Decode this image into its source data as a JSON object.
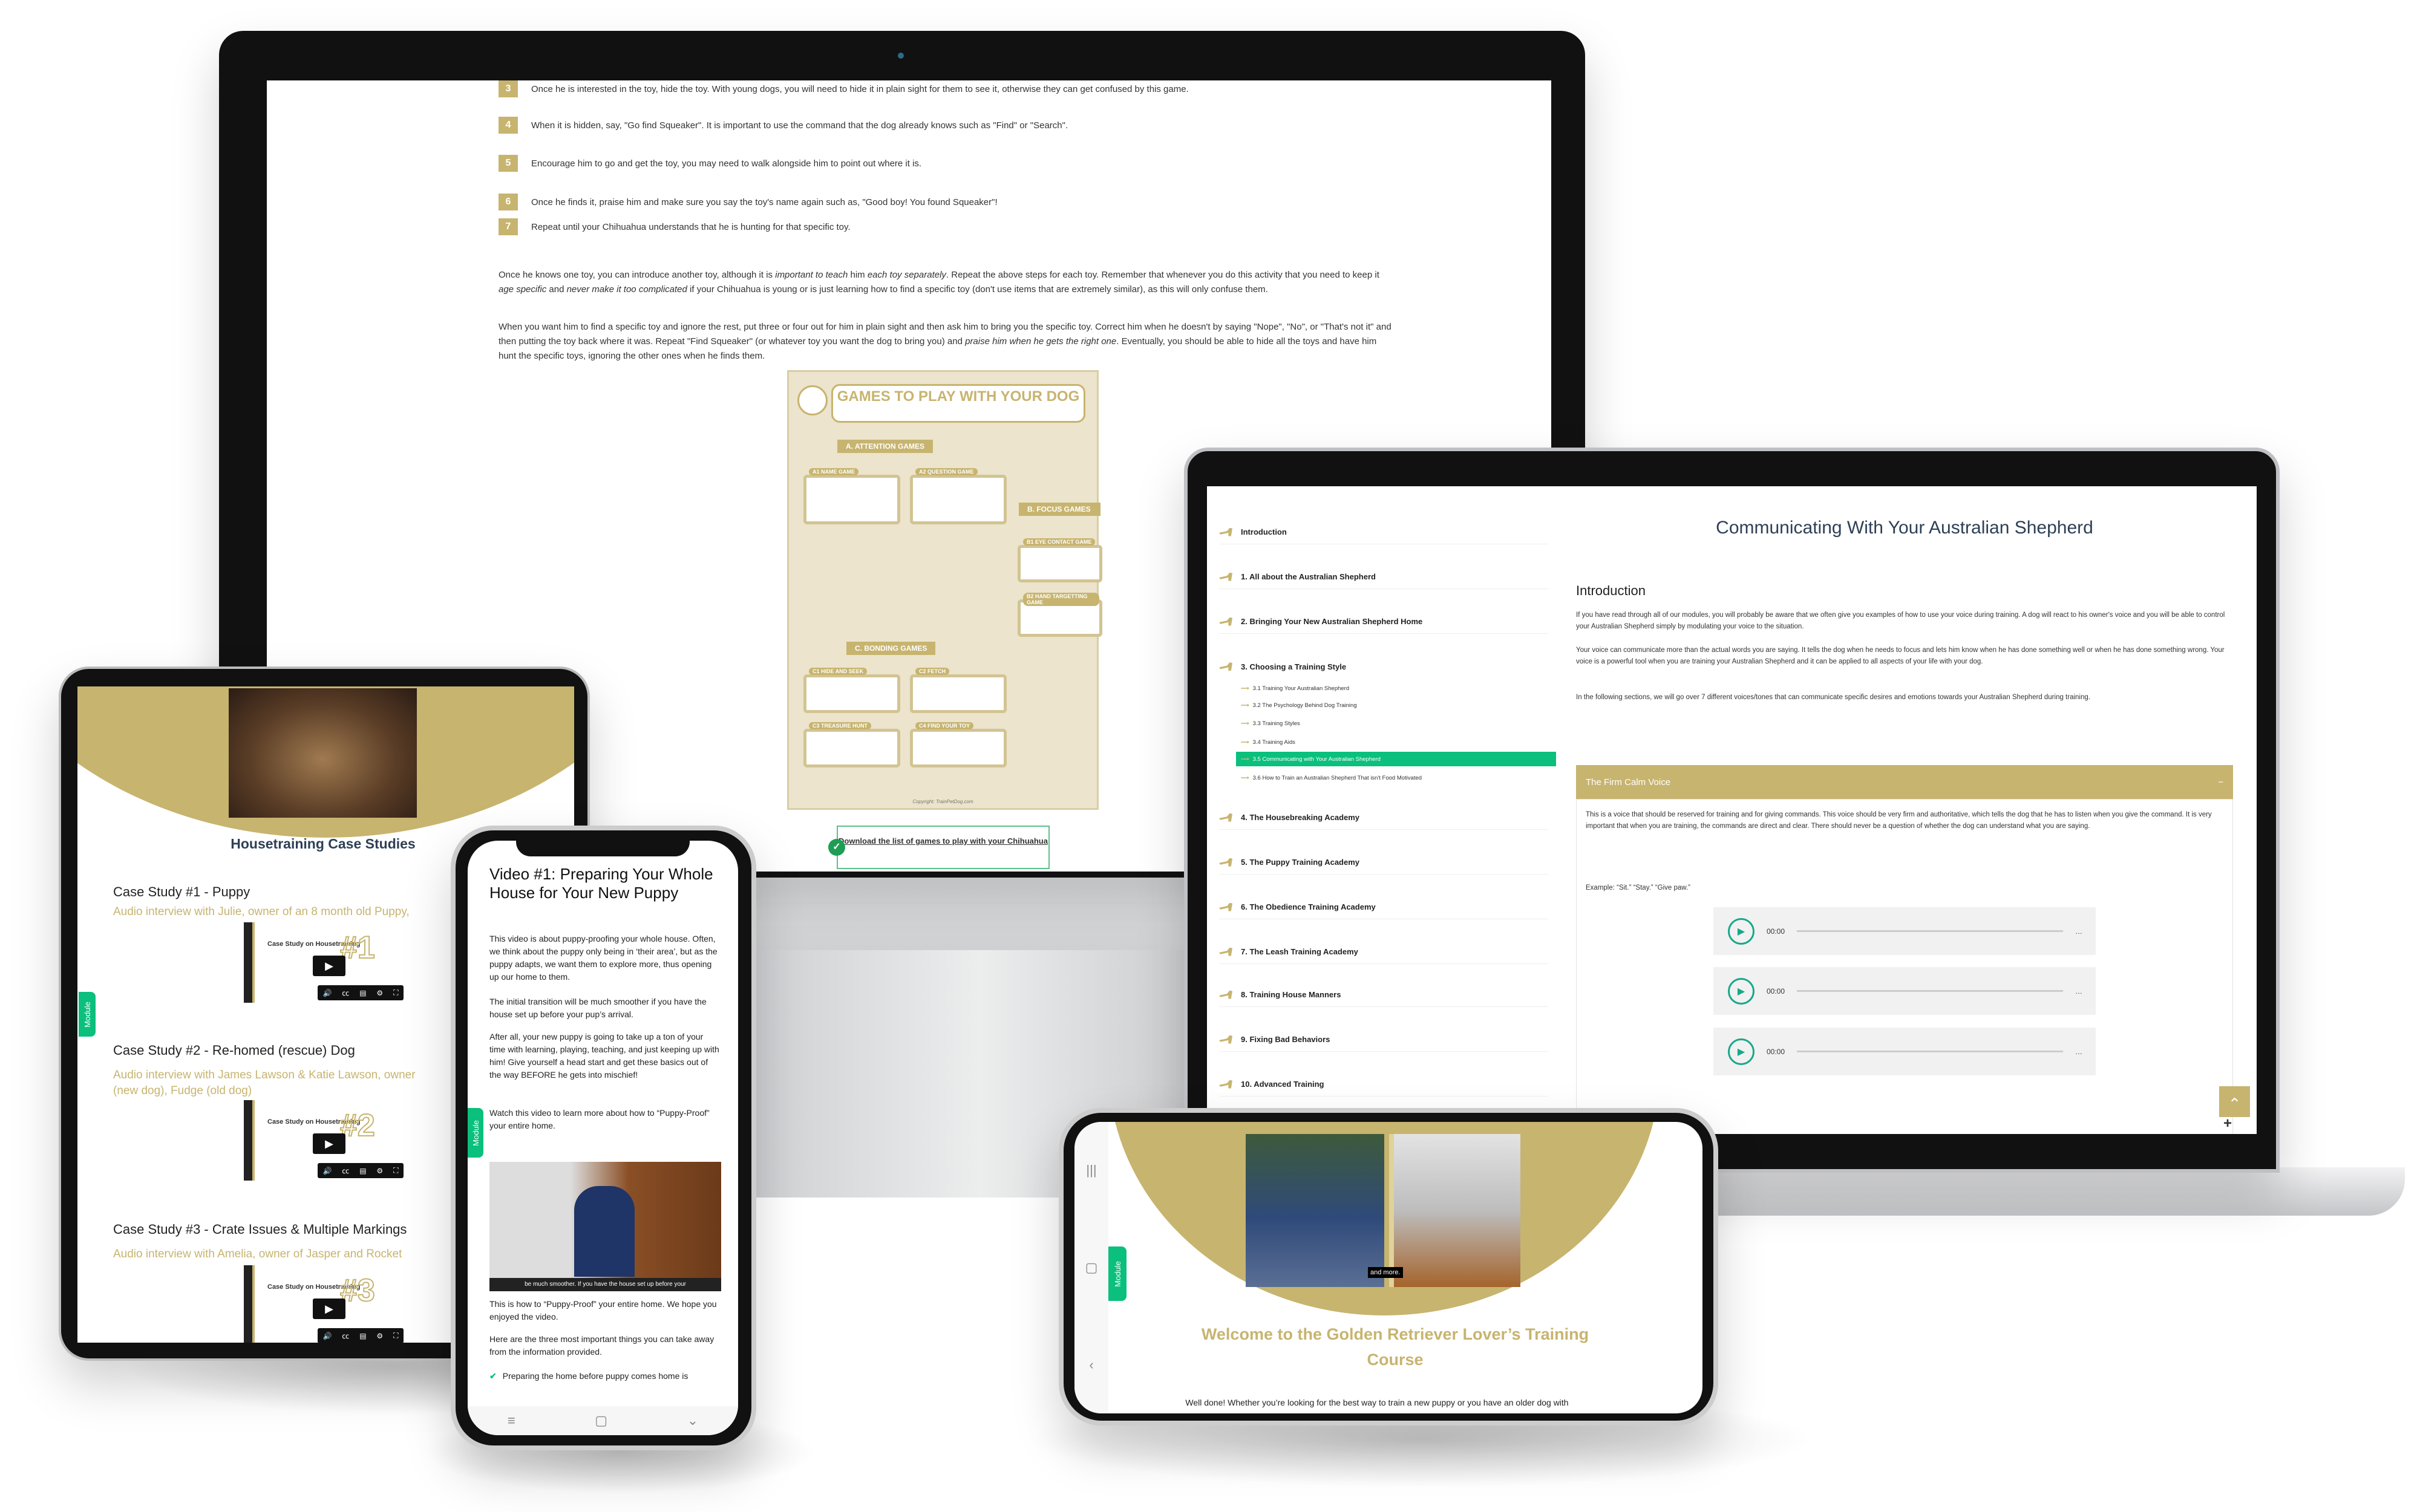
{
  "colors": {
    "gold": "#c7b46f",
    "green": "#0bbf7d",
    "navy": "#2e3f55"
  },
  "monitor": {
    "steps": [
      {
        "num": "3",
        "text": "Once he is interested in the toy, hide the toy. With young dogs, you will need to hide it in plain sight for them to see it, otherwise they can get confused by this game."
      },
      {
        "num": "4",
        "text": "When it is hidden, say, \"Go find Squeaker\". It is important to use the command that the dog already knows such as \"Find\" or \"Search\"."
      },
      {
        "num": "5",
        "text": "Encourage him to go and get the toy, you may need to walk alongside him to point out where it is."
      },
      {
        "num": "6",
        "text": "Once he finds it, praise him and make sure you say the toy's name again such as, \"Good boy! You found Squeaker\"!"
      },
      {
        "num": "7",
        "text": "Repeat until your Chihuahua understands that he is hunting for that specific toy."
      }
    ],
    "para1": {
      "a": "Once he knows one toy, you can introduce another toy, although it is ",
      "b": "important to teach",
      "c": " him ",
      "d": "each toy separately",
      "e": ". Repeat the above steps for each toy. Remember that whenever you do this activity that you need to keep it ",
      "f": "age specific",
      "g": " and ",
      "h": "never make it too complicated",
      "i": " if your Chihuahua is young or is just learning how to find a specific toy (don't use items that are extremely similar), as this will only confuse them."
    },
    "para2": {
      "a": "When you want him to find a specific toy and ignore the rest, put three or four out for him in plain sight and then ask him to bring you the specific toy. Correct him when he doesn't by saying \"Nope\", \"No\", or \"That's not it\" and then putting the toy back where it was. Repeat \"Find Squeaker\" (or whatever toy you want the dog to bring you) and ",
      "b": "praise him when he gets the right one",
      "c": ". Eventually, you should be able to hide all the toys and have him hunt the specific toys, ignoring the other ones when he finds them."
    },
    "poster": {
      "title": "GAMES TO PLAY WITH YOUR DOG",
      "section_a": "A. ATTENTION GAMES",
      "section_b": "B. FOCUS GAMES",
      "section_c": "C. BONDING GAMES",
      "cards": [
        "A1 NAME GAME",
        "A2 QUESTION GAME",
        "B1 EYE CONTACT GAME",
        "B2 HAND TARGETTING GAME",
        "C1 HIDE AND SEEK",
        "C2 FETCH",
        "C3 TREASURE HUNT",
        "C4 FIND YOUR TOY"
      ],
      "copyright": "Copyright: TrainPetDog.com"
    },
    "download_link": "Download the list of games to play with your Chihuahua"
  },
  "laptop": {
    "sidebar": [
      {
        "label": "Introduction"
      },
      {
        "label": "1. All about the Australian Shepherd"
      },
      {
        "label": "2. Bringing Your New Australian Shepherd Home"
      },
      {
        "label": "3. Choosing a Training Style"
      },
      {
        "label": "4. The Housebreaking Academy"
      },
      {
        "label": "5. The Puppy Training Academy"
      },
      {
        "label": "6. The Obedience Training Academy"
      },
      {
        "label": "7. The Leash Training Academy"
      },
      {
        "label": "8. Training House Manners"
      },
      {
        "label": "9. Fixing Bad Behaviors"
      },
      {
        "label": "10. Advanced Training"
      }
    ],
    "subitems": [
      {
        "label": "3.1 Training Your Australian Shepherd"
      },
      {
        "label": "3.2 The Psychology Behind Dog Training"
      },
      {
        "label": "3.3 Training Styles"
      },
      {
        "label": "3.4 Training Aids"
      },
      {
        "label": "3.5 Communicating with Your Australian Shepherd",
        "active": true
      },
      {
        "label": "3.6 How to Train an Australian Shepherd That isn't Food Motivated"
      }
    ],
    "title": "Communicating With Your Australian Shepherd",
    "intro_heading": "Introduction",
    "paras": [
      "If you have read through all of our modules, you will probably be aware that we often give you examples of how to use your voice during training. A dog will react to his owner's voice and you will be able to control your Australian Shepherd simply by modulating your voice to the situation.",
      "Your voice can communicate more than the actual words you are saying. It tells the dog when he needs to focus and lets him know when he has done something well or when he has done something wrong. Your voice is a powerful tool when you are training your Australian Shepherd and it can be applied to all aspects of your life with your dog.",
      "In the following sections, we will go over 7 different voices/tones that can communicate specific desires and emotions towards your Australian Shepherd during training."
    ],
    "accordion": {
      "title": "The Firm Calm Voice",
      "toggle": "−",
      "body": "This is a voice that should be reserved for training and for giving commands. This voice should be very firm and authoritative, which tells the dog that he has to listen when you give the command. It is very important that when you are training, the commands are direct and clear. There should never be a question of whether the dog can understand what you are saying.",
      "example": "Example: “Sit.” “Stay.” “Give paw.”"
    },
    "audio_players": [
      {
        "time": "00:00"
      },
      {
        "time": "00:00"
      },
      {
        "time": "00:00"
      }
    ],
    "scroll_top": "⌃",
    "plus": "+"
  },
  "tablet": {
    "heading": "Housetraining Case Studies",
    "module_tab": "Module",
    "cases": [
      {
        "title": "Case Study #1  - Puppy",
        "sub": [
          "Audio interview with Julie, owner of an 8 month old Puppy,"
        ],
        "thumb_title": "Case Study on Housetraining",
        "num": "#1"
      },
      {
        "title": "Case Study #2 - Re-homed (rescue) Dog",
        "sub": [
          "Audio interview with James Lawson & Katie Lawson, owner",
          "(new dog), Fudge (old dog)"
        ],
        "thumb_title": "Case Study on Housetraining",
        "num": "#2"
      },
      {
        "title": "Case Study #3 - Crate Issues & Multiple Markings",
        "sub": [
          "Audio interview with Amelia, owner of Jasper and Rocket"
        ],
        "thumb_title": "Case Study on Housetraining",
        "num": "#3"
      }
    ]
  },
  "phone": {
    "title": "Video #1: Preparing Your Whole House for Your New Puppy",
    "module_tab": "Module",
    "paras": [
      "This video is about puppy-proofing your whole house. Often, we think about the puppy only being in ‘their area’, but as the puppy adapts, we want them to explore more, thus opening up our home to them.",
      "The initial transition will be much smoother if you have the house set up before your pup’s arrival.",
      "After all, your new puppy is going to take up a ton of your time with learning, playing, teaching, and just keeping up with him! Give yourself a head start and get these basics out of the way BEFORE he gets into mischief!",
      "Watch this video to learn more about how to “Puppy-Proof” your entire home."
    ],
    "video_caption": "be much smoother. If you have the house set up before your",
    "after": [
      "This is how to “Puppy-Proof” your entire home. We hope you enjoyed the video.",
      "Here are the three most important things you can take away from the information provided."
    ],
    "check_item": "Preparing the home before puppy comes home is"
  },
  "landscape": {
    "caption": "and more.",
    "module_tab": "Module",
    "heading": "Welcome to the Golden Retriever Lover’s Training Course",
    "para": "Well done! Whether you’re looking for the best way to train a new puppy or you have an older dog with"
  }
}
